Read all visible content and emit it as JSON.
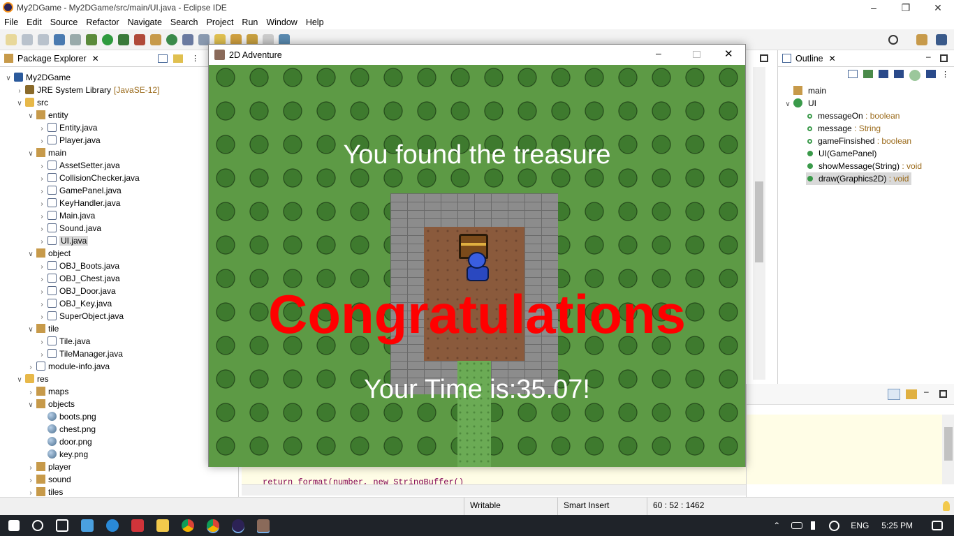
{
  "window": {
    "title": "My2DGame - My2DGame/src/main/UI.java - Eclipse IDE"
  },
  "menu": [
    "File",
    "Edit",
    "Source",
    "Refactor",
    "Navigate",
    "Search",
    "Project",
    "Run",
    "Window",
    "Help"
  ],
  "package_explorer": {
    "title": "Package Explorer",
    "tree": [
      {
        "label": "My2DGame",
        "icon": "project-icon",
        "level": 0,
        "twisty": "v"
      },
      {
        "label": "JRE System Library",
        "extra": "[JavaSE-12]",
        "icon": "library-icon",
        "level": 1,
        "twisty": ">"
      },
      {
        "label": "src",
        "icon": "source-folder-icon",
        "level": 1,
        "twisty": "v"
      },
      {
        "label": "entity",
        "icon": "package-icon",
        "level": 2,
        "twisty": "v"
      },
      {
        "label": "Entity.java",
        "icon": "java-file-icon",
        "level": 3,
        "twisty": ">"
      },
      {
        "label": "Player.java",
        "icon": "java-file-icon",
        "level": 3,
        "twisty": ">"
      },
      {
        "label": "main",
        "icon": "package-icon",
        "level": 2,
        "twisty": "v"
      },
      {
        "label": "AssetSetter.java",
        "icon": "java-file-icon",
        "level": 3,
        "twisty": ">"
      },
      {
        "label": "CollisionChecker.java",
        "icon": "java-file-icon",
        "level": 3,
        "twisty": ">"
      },
      {
        "label": "GamePanel.java",
        "icon": "java-file-icon",
        "level": 3,
        "twisty": ">"
      },
      {
        "label": "KeyHandler.java",
        "icon": "java-file-icon",
        "level": 3,
        "twisty": ">"
      },
      {
        "label": "Main.java",
        "icon": "java-file-icon",
        "level": 3,
        "twisty": ">"
      },
      {
        "label": "Sound.java",
        "icon": "java-file-icon",
        "level": 3,
        "twisty": ">"
      },
      {
        "label": "UI.java",
        "icon": "java-file-icon",
        "level": 3,
        "twisty": ">",
        "selected": true
      },
      {
        "label": "object",
        "icon": "package-icon",
        "level": 2,
        "twisty": "v"
      },
      {
        "label": "OBJ_Boots.java",
        "icon": "java-file-icon",
        "level": 3,
        "twisty": ">"
      },
      {
        "label": "OBJ_Chest.java",
        "icon": "java-file-icon",
        "level": 3,
        "twisty": ">"
      },
      {
        "label": "OBJ_Door.java",
        "icon": "java-file-icon",
        "level": 3,
        "twisty": ">"
      },
      {
        "label": "OBJ_Key.java",
        "icon": "java-file-icon",
        "level": 3,
        "twisty": ">"
      },
      {
        "label": "SuperObject.java",
        "icon": "java-file-icon",
        "level": 3,
        "twisty": ">"
      },
      {
        "label": "tile",
        "icon": "package-icon",
        "level": 2,
        "twisty": "v"
      },
      {
        "label": "Tile.java",
        "icon": "java-file-icon",
        "level": 3,
        "twisty": ">"
      },
      {
        "label": "TileManager.java",
        "icon": "java-file-icon",
        "level": 3,
        "twisty": ">"
      },
      {
        "label": "module-info.java",
        "icon": "java-file-icon",
        "level": 2,
        "twisty": ">"
      },
      {
        "label": "res",
        "icon": "folder-icon",
        "level": 1,
        "twisty": "v"
      },
      {
        "label": "maps",
        "icon": "package-icon",
        "level": 2,
        "twisty": ">"
      },
      {
        "label": "objects",
        "icon": "package-icon",
        "level": 2,
        "twisty": "v"
      },
      {
        "label": "boots.png",
        "icon": "image-file-icon",
        "level": 3,
        "twisty": ""
      },
      {
        "label": "chest.png",
        "icon": "image-file-icon",
        "level": 3,
        "twisty": ""
      },
      {
        "label": "door.png",
        "icon": "image-file-icon",
        "level": 3,
        "twisty": ""
      },
      {
        "label": "key.png",
        "icon": "image-file-icon",
        "level": 3,
        "twisty": ""
      },
      {
        "label": "player",
        "icon": "package-icon",
        "level": 2,
        "twisty": ">"
      },
      {
        "label": "sound",
        "icon": "package-icon",
        "level": 2,
        "twisty": ">"
      },
      {
        "label": "tiles",
        "icon": "package-icon",
        "level": 2,
        "twisty": ">"
      }
    ]
  },
  "outline": {
    "title": "Outline",
    "items": [
      {
        "label": "main",
        "type": "",
        "level": 0,
        "icon": "package-icon",
        "twisty": ""
      },
      {
        "label": "UI",
        "type": "",
        "level": 0,
        "icon": "class-icon",
        "twisty": "v"
      },
      {
        "label": "messageOn",
        "type": " : boolean",
        "level": 1,
        "icon": "field-icon"
      },
      {
        "label": "message",
        "type": " : String",
        "level": 1,
        "icon": "field-icon"
      },
      {
        "label": "gameFinsished",
        "type": " : boolean",
        "level": 1,
        "icon": "field-icon"
      },
      {
        "label": "UI(GamePanel)",
        "type": "",
        "level": 1,
        "icon": "constructor-icon"
      },
      {
        "label": "showMessage(String)",
        "type": " : void",
        "level": 1,
        "icon": "method-icon"
      },
      {
        "label": "draw(Graphics2D)",
        "type": " : void",
        "level": 1,
        "icon": "method-icon",
        "selected": true
      }
    ]
  },
  "editor": {
    "visible_code": "return format(number, new StringBuffer()"
  },
  "status": {
    "mode": "Writable",
    "insert": "Smart Insert",
    "position": "60 : 52 : 1462"
  },
  "game": {
    "title": "2D Adventure",
    "message_found": "You found the treasure",
    "message_congrats": "Congratulations",
    "message_time": "Your Time is:35.07!"
  },
  "taskbar": {
    "time": "5:25 PM",
    "language": "ENG"
  },
  "colors": {
    "congrats": "#ff0000",
    "grass": "#5d9a45",
    "tree": "#3e7a2e",
    "dirt": "#8a5a3c",
    "stone": "#8c8c8c"
  }
}
